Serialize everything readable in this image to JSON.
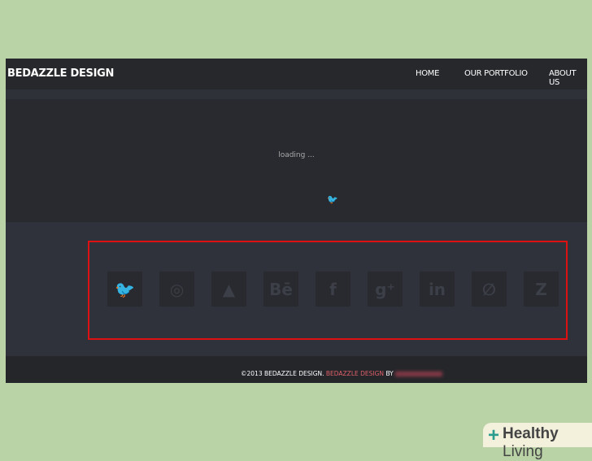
{
  "header": {
    "logo": "BEDAZZLE DESIGN",
    "nav": [
      "HOME",
      "OUR PORTFOLIO",
      "ABOUT US"
    ]
  },
  "hero": {
    "loading": "loading ...",
    "icon": "twitter-icon"
  },
  "social": {
    "icons": [
      {
        "name": "twitter-icon",
        "glyph": "🐦"
      },
      {
        "name": "dribbble-icon",
        "glyph": "◎"
      },
      {
        "name": "forrst-icon",
        "glyph": "▲"
      },
      {
        "name": "behance-icon",
        "glyph": "Bē"
      },
      {
        "name": "facebook-icon",
        "glyph": "f"
      },
      {
        "name": "google-plus-icon",
        "glyph": "g⁺"
      },
      {
        "name": "linkedin-icon",
        "glyph": "in"
      },
      {
        "name": "evernote-icon",
        "glyph": "∅"
      },
      {
        "name": "zerply-icon",
        "glyph": "Z"
      }
    ]
  },
  "footer": {
    "copyright": "©2013 BEDAZZLE DESIGN.",
    "link": "BEDAZZLE DESIGN",
    "by": "BY"
  },
  "watermark": {
    "bold": "Healthy",
    "light": "Living"
  },
  "colors": {
    "accent": "#e0606a",
    "highlight": "#dd1111",
    "background": "#b9d3a6"
  }
}
